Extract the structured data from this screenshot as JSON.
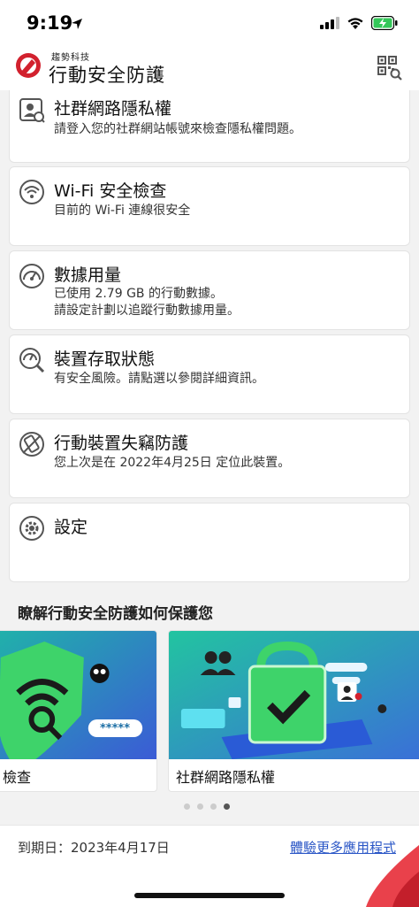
{
  "status_bar": {
    "time": "9:19"
  },
  "header": {
    "brand_sub": "趨勢科技",
    "brand_title": "行動安全防護",
    "qr_icon": "qr-scan-icon"
  },
  "cards": [
    {
      "icon": "social-privacy-icon",
      "title": "社群網路隱私權",
      "desc": [
        "請登入您的社群網站帳號來檢查隱私權問題。"
      ]
    },
    {
      "icon": "wifi-check-icon",
      "title": "Wi-Fi 安全檢查",
      "desc": [
        "目前的 Wi-Fi 連線很安全"
      ]
    },
    {
      "icon": "data-usage-icon",
      "title": "數據用量",
      "desc": [
        "已使用 2.79 GB 的行動數據。",
        "請設定計劃以追蹤行動數據用量。"
      ]
    },
    {
      "icon": "device-access-icon",
      "title": "裝置存取狀態",
      "desc": [
        "有安全風險。請點選以參閱詳細資訊。"
      ]
    },
    {
      "icon": "lost-device-icon",
      "title": "行動裝置失竊防護",
      "desc": [
        "您上次是在 2022年4月25日 定位此裝置。"
      ]
    },
    {
      "icon": "settings-gear-icon",
      "title": "設定",
      "desc": []
    }
  ],
  "section_title": "瞭解行動安全防護如何保護您",
  "promos": [
    {
      "label": "檢查",
      "badge_text": "*****"
    },
    {
      "label": "社群網路隱私權"
    }
  ],
  "carousel": {
    "count": 4,
    "active_index": 3
  },
  "footer": {
    "expiry": "到期日：2023年4月17日",
    "more_apps": "體驗更多應用程式"
  },
  "colors": {
    "accent": "#d2212e",
    "link": "#2a56c6",
    "promo_green": "#3ed36a",
    "promo_teal": "#1fb5a8"
  }
}
